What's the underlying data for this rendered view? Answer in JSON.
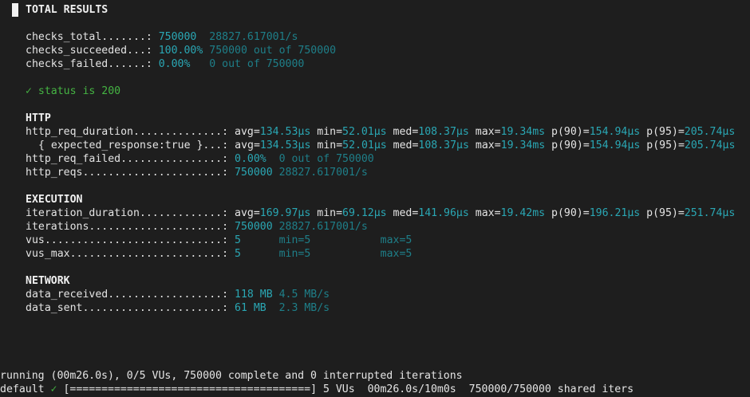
{
  "header": {
    "title": "TOTAL RESULTS"
  },
  "summary": {
    "checks_total": {
      "label": "checks_total.......: ",
      "value": "750000",
      "rate": "28827.617001/s"
    },
    "checks_succeeded": {
      "label": "checks_succeeded...: ",
      "value": "100.00%",
      "detail": "750000 out of 750000"
    },
    "checks_failed": {
      "label": "checks_failed......: ",
      "value": "0.00%",
      "detail": "0 out of 750000"
    }
  },
  "check": {
    "mark": "✓",
    "text": "status is 200"
  },
  "http": {
    "heading": "HTTP",
    "req_duration": {
      "label": "http_req_duration..............: ",
      "avg": "134.53µs",
      "min": "52.01µs",
      "med": "108.37µs",
      "max": "19.34ms",
      "p90": "154.94µs",
      "p95": "205.74µs"
    },
    "expected_response": {
      "label": "{ expected_response:true }...: ",
      "avg": "134.53µs",
      "min": "52.01µs",
      "med": "108.37µs",
      "max": "19.34ms",
      "p90": "154.94µs",
      "p95": "205.74µs"
    },
    "req_failed": {
      "label": "http_req_failed................: ",
      "value": "0.00%",
      "detail": "0 out of 750000"
    },
    "reqs": {
      "label": "http_reqs......................: ",
      "value": "750000",
      "rate": "28827.617001/s"
    }
  },
  "execution": {
    "heading": "EXECUTION",
    "iteration_duration": {
      "label": "iteration_duration.............: ",
      "avg": "169.97µs",
      "min": "69.12µs",
      "med": "141.96µs",
      "max": "19.42ms",
      "p90": "196.21µs",
      "p95": "251.74µs"
    },
    "iterations": {
      "label": "iterations.....................: ",
      "value": "750000",
      "rate": "28827.617001/s"
    },
    "vus": {
      "label": "vus............................: ",
      "value": "5",
      "min": "min=5",
      "max": "max=5"
    },
    "vus_max": {
      "label": "vus_max........................: ",
      "value": "5",
      "min": "min=5",
      "max": "max=5"
    }
  },
  "network": {
    "heading": "NETWORK",
    "data_received": {
      "label": "data_received..................: ",
      "value": "118 MB",
      "rate": "4.5 MB/s"
    },
    "data_sent": {
      "label": "data_sent......................: ",
      "value": "61 MB",
      "rate": "2.3 MB/s"
    }
  },
  "footer": {
    "status_line": "running (00m26.0s), 0/5 VUs, 750000 complete and 0 interrupted iterations",
    "scenario": "default",
    "check_mark": "✓",
    "progress": "[======================================]",
    "progress_fraction": 1.0,
    "vus": "5 VUs",
    "time": "00m26.0s/10m0s",
    "iters": "750000/750000 shared iters"
  },
  "colors": {
    "background": "#1e1e1e",
    "text": "#e4e4e4",
    "teal": "#2aa7b4",
    "dim_teal": "#1e7f89",
    "green": "#45b443"
  }
}
